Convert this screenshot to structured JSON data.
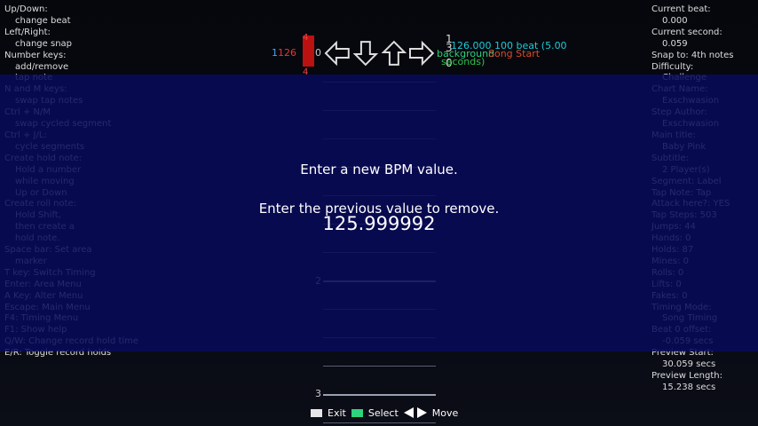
{
  "help_left": [
    {
      "text": "Up/Down:",
      "indent": false
    },
    {
      "text": "change beat",
      "indent": true
    },
    {
      "text": "Left/Right:",
      "indent": false
    },
    {
      "text": "change snap",
      "indent": true
    },
    {
      "text": "Number keys:",
      "indent": false
    },
    {
      "text": "add/remove",
      "indent": true
    },
    {
      "text": "tap note",
      "indent": true
    },
    {
      "text": "N and M keys:",
      "indent": false
    },
    {
      "text": "swap tap notes",
      "indent": true
    },
    {
      "text": "Ctrl + N/M",
      "indent": false
    },
    {
      "text": "swap cycled segment",
      "indent": true
    },
    {
      "text": "Ctrl + J/L:",
      "indent": false
    },
    {
      "text": "cycle segments",
      "indent": true
    },
    {
      "text": "Create hold note:",
      "indent": false
    },
    {
      "text": "Hold a number",
      "indent": true
    },
    {
      "text": "while moving",
      "indent": true
    },
    {
      "text": "Up or Down",
      "indent": true
    },
    {
      "text": "Create roll note:",
      "indent": false
    },
    {
      "text": "Hold Shift,",
      "indent": true
    },
    {
      "text": "then create a",
      "indent": true
    },
    {
      "text": "hold note.",
      "indent": true
    },
    {
      "text": "Space bar: Set area",
      "indent": false
    },
    {
      "text": "marker",
      "indent": true
    },
    {
      "text": "T key: Switch Timing",
      "indent": false
    },
    {
      "text": "Enter: Area Menu",
      "indent": false
    },
    {
      "text": "A Key: Alter Menu",
      "indent": false
    },
    {
      "text": "Escape: Main Menu",
      "indent": false
    },
    {
      "text": "F4: Timing Menu",
      "indent": false
    },
    {
      "text": "F1: Show help",
      "indent": false
    },
    {
      "text": "Q/W: Change record hold time",
      "indent": false
    },
    {
      "text": "E/R: Toggle record holds",
      "indent": false
    }
  ],
  "info_right": [
    {
      "text": "Current beat:",
      "indent": false
    },
    {
      "text": "0.000",
      "indent": true
    },
    {
      "text": "Current second:",
      "indent": false
    },
    {
      "text": "0.059",
      "indent": true
    },
    {
      "text": "Snap to: 4th notes",
      "indent": false
    },
    {
      "text": "Difficulty:",
      "indent": false
    },
    {
      "text": "Challenge",
      "indent": true
    },
    {
      "text": "Chart Name:",
      "indent": false
    },
    {
      "text": "Exschwasion",
      "indent": true
    },
    {
      "text": "Step Author:",
      "indent": false
    },
    {
      "text": "Exschwasion",
      "indent": true
    },
    {
      "text": "Main title:",
      "indent": false
    },
    {
      "text": "Baby Pink",
      "indent": true
    },
    {
      "text": "Subtitle:",
      "indent": false
    },
    {
      "text": "2 Player(s)",
      "indent": true
    },
    {
      "text": "Segment: Label",
      "indent": false
    },
    {
      "text": "Tap Note: Tap",
      "indent": false
    },
    {
      "text": "Attack here?: YES",
      "indent": false
    },
    {
      "text": "Tap Steps: 503",
      "indent": false
    },
    {
      "text": "Jumps: 44",
      "indent": false
    },
    {
      "text": "Hands: 0",
      "indent": false
    },
    {
      "text": "Holds: 87",
      "indent": false
    },
    {
      "text": "Mines: 0",
      "indent": false
    },
    {
      "text": "Rolls: 0",
      "indent": false
    },
    {
      "text": "Lifts: 0",
      "indent": false
    },
    {
      "text": "Fakes: 0",
      "indent": false
    },
    {
      "text": "Timing Mode:",
      "indent": false
    },
    {
      "text": "Song Timing",
      "indent": true
    },
    {
      "text": "Beat 0 offset:",
      "indent": false
    },
    {
      "text": "-0.059 secs",
      "indent": true
    },
    {
      "text": "Preview Start:",
      "indent": false
    },
    {
      "text": "30.059 secs",
      "indent": true
    },
    {
      "text": "Preview Length:",
      "indent": false
    },
    {
      "text": "15.238 secs",
      "indent": true
    }
  ],
  "lane": {
    "measure_labels": [
      "0",
      "2",
      "3"
    ],
    "bpm_left_a": "1",
    "bpm_left_b": "126",
    "stop_top": "4",
    "stop_bottom": "4",
    "right_marker_top": "1",
    "right_marker_mid": "3",
    "right_marker_bottom": "0",
    "bpm_label": "126.000 100 beat (5.00",
    "bg_label": "background",
    "song_label": "Song Start",
    "seconds_label": "seconds)"
  },
  "dialog": {
    "title": "Enter a new BPM value.",
    "subtitle": "Enter the previous value to remove.",
    "value": "125.999992"
  },
  "footer": {
    "exit": "Exit",
    "select": "Select",
    "move": "Move"
  },
  "colors": {
    "overlay": "#08105a",
    "accent_cyan": "#1ccbd8",
    "accent_green": "#2dd37d",
    "accent_red": "#d94a2b"
  }
}
